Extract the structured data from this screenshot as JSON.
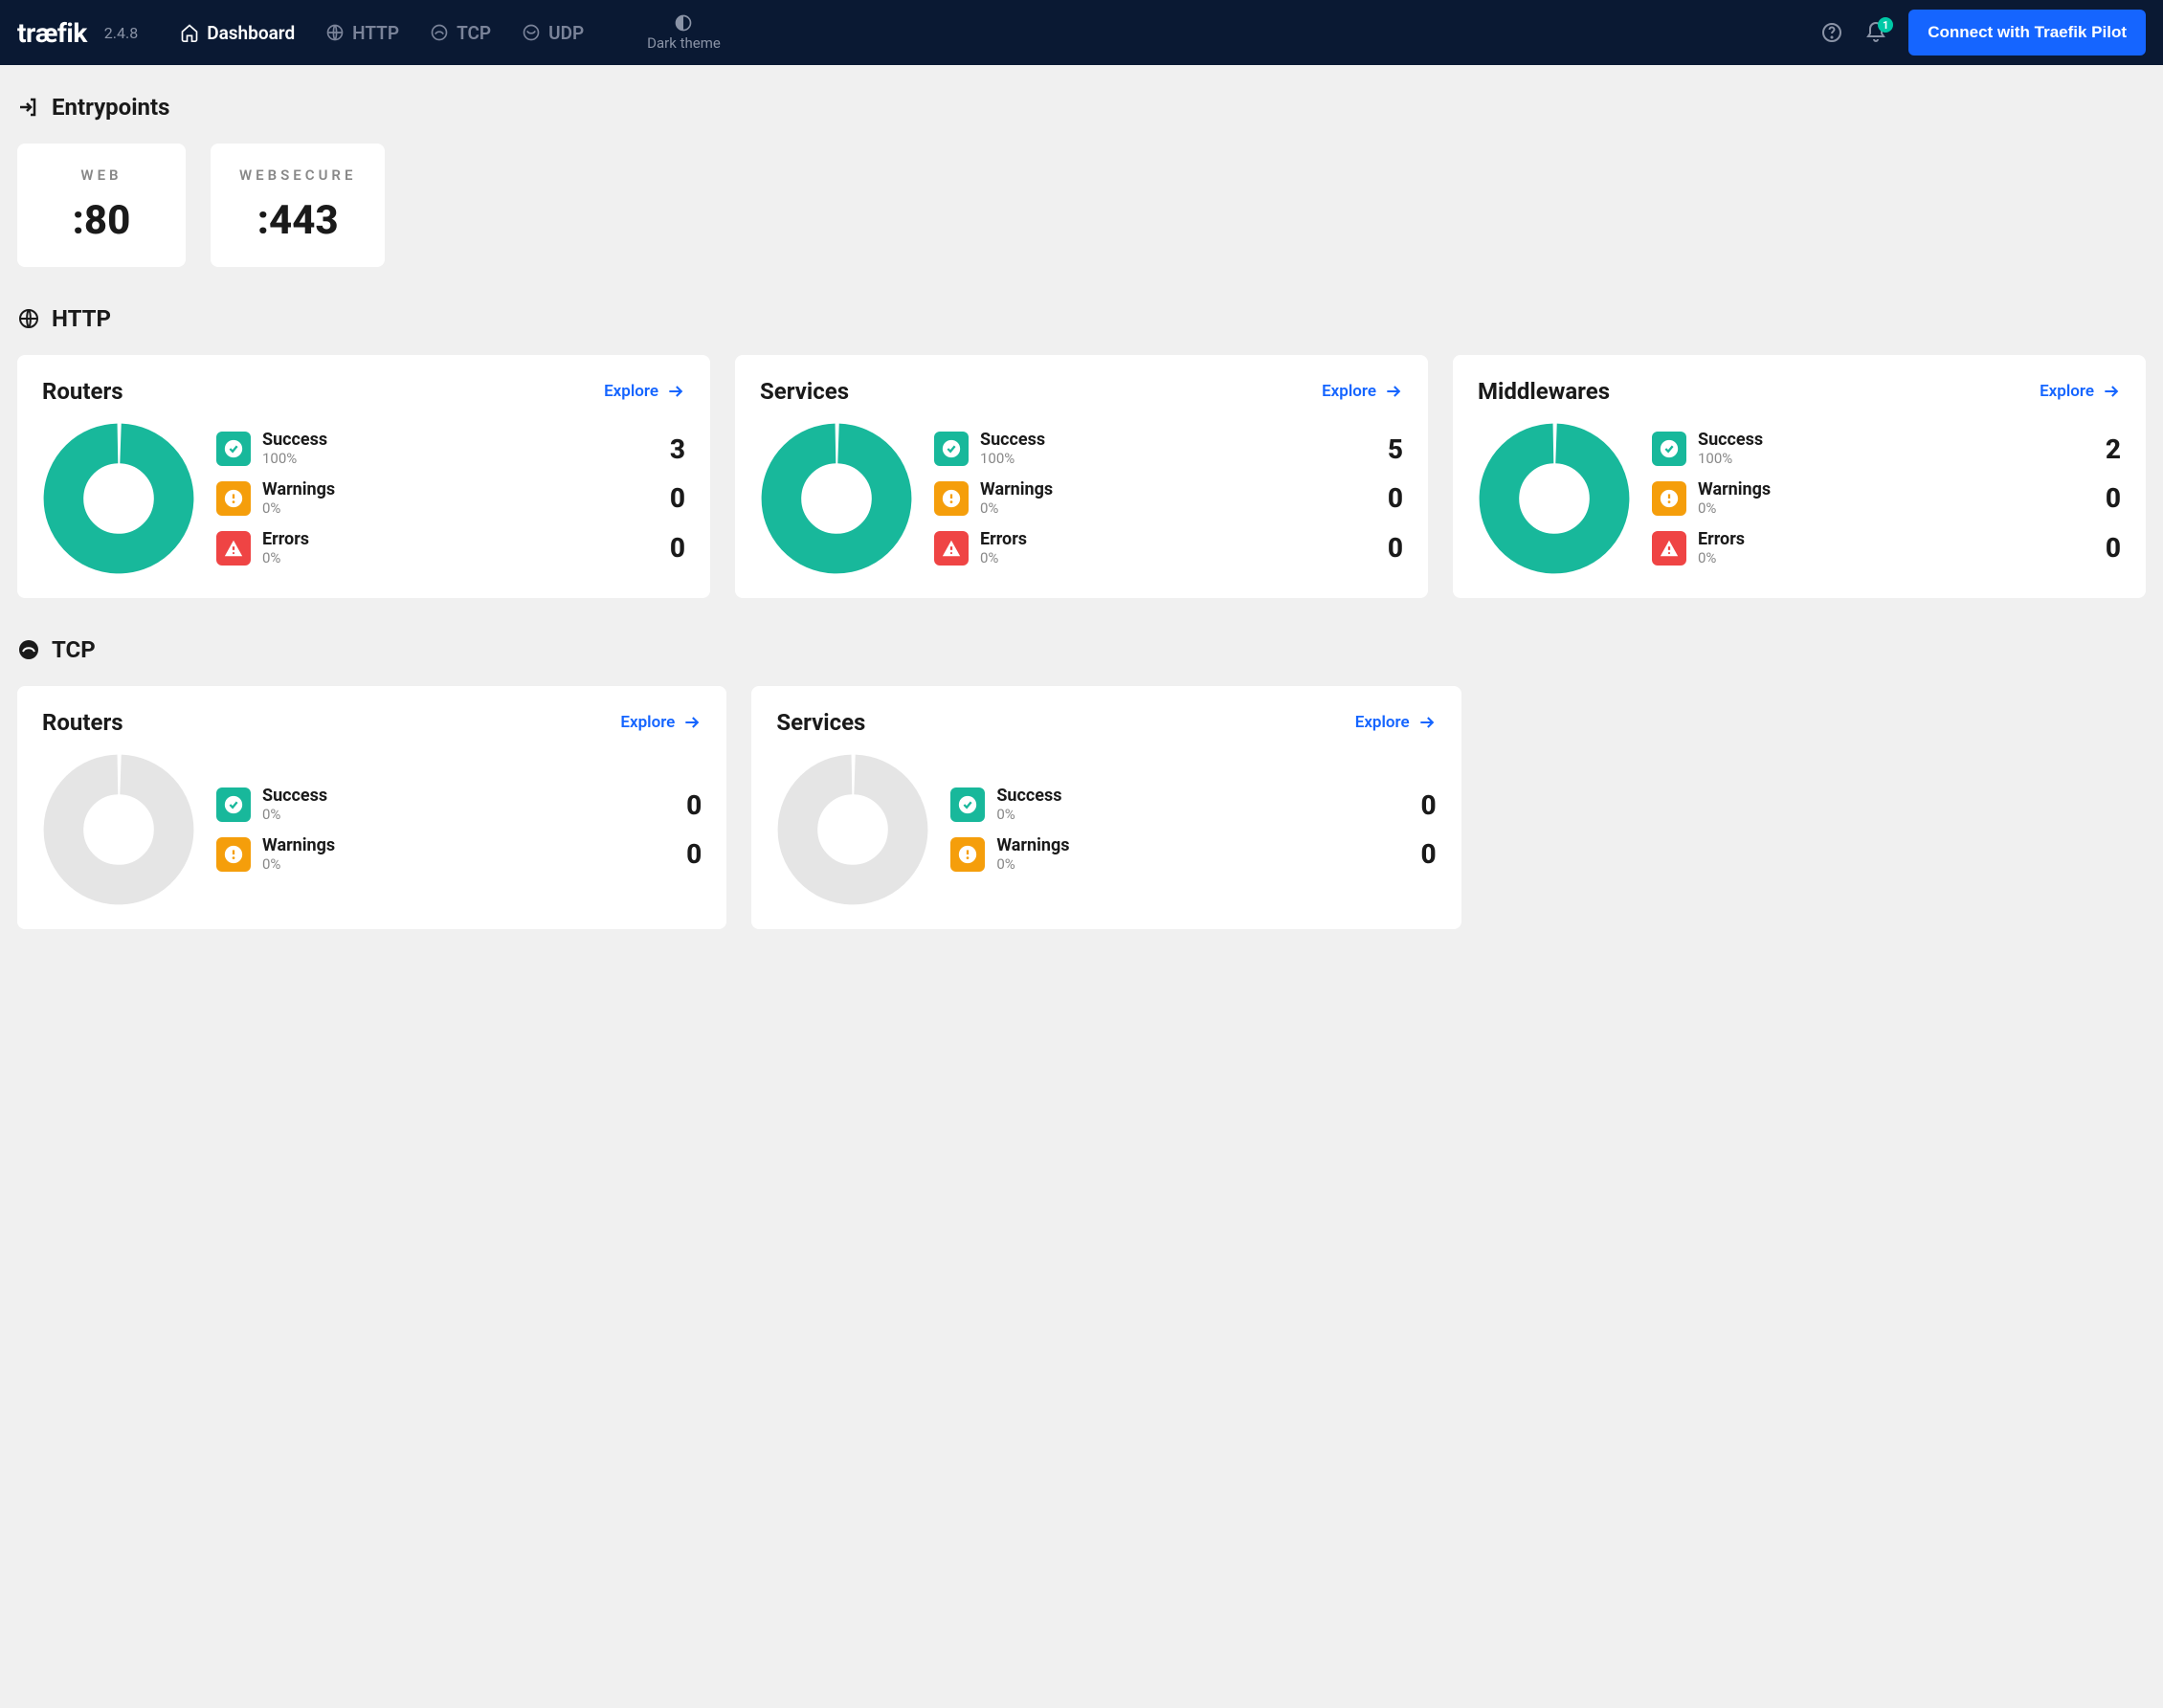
{
  "header": {
    "logo": "træfik",
    "version": "2.4.8",
    "nav": {
      "dashboard": "Dashboard",
      "http": "HTTP",
      "tcp": "TCP",
      "udp": "UDP"
    },
    "theme_toggle": "Dark theme",
    "notif_count": "1",
    "pilot_button": "Connect with Traefik Pilot"
  },
  "sections": {
    "entrypoints": {
      "title": "Entrypoints"
    },
    "http": {
      "title": "HTTP"
    },
    "tcp": {
      "title": "TCP"
    }
  },
  "entrypoints": [
    {
      "name": "WEB",
      "port": ":80"
    },
    {
      "name": "WEBSECURE",
      "port": ":443"
    }
  ],
  "labels": {
    "explore": "Explore",
    "success": "Success",
    "warnings": "Warnings",
    "errors": "Errors"
  },
  "http_panels": {
    "routers": {
      "title": "Routers",
      "success_pct": "100%",
      "success_n": "3",
      "warn_pct": "0%",
      "warn_n": "0",
      "err_pct": "0%",
      "err_n": "0",
      "donut_color": "#18b89b"
    },
    "services": {
      "title": "Services",
      "success_pct": "100%",
      "success_n": "5",
      "warn_pct": "0%",
      "warn_n": "0",
      "err_pct": "0%",
      "err_n": "0",
      "donut_color": "#18b89b"
    },
    "middlewares": {
      "title": "Middlewares",
      "success_pct": "100%",
      "success_n": "2",
      "warn_pct": "0%",
      "warn_n": "0",
      "err_pct": "0%",
      "err_n": "0",
      "donut_color": "#18b89b"
    }
  },
  "tcp_panels": {
    "routers": {
      "title": "Routers",
      "success_pct": "0%",
      "success_n": "0",
      "warn_pct": "0%",
      "warn_n": "0",
      "donut_color": "#e5e5e5"
    },
    "services": {
      "title": "Services",
      "success_pct": "0%",
      "success_n": "0",
      "warn_pct": "0%",
      "warn_n": "0",
      "donut_color": "#e5e5e5"
    }
  },
  "chart_data": [
    {
      "type": "pie",
      "title": "HTTP Routers",
      "categories": [
        "Success",
        "Warnings",
        "Errors"
      ],
      "values": [
        3,
        0,
        0
      ]
    },
    {
      "type": "pie",
      "title": "HTTP Services",
      "categories": [
        "Success",
        "Warnings",
        "Errors"
      ],
      "values": [
        5,
        0,
        0
      ]
    },
    {
      "type": "pie",
      "title": "HTTP Middlewares",
      "categories": [
        "Success",
        "Warnings",
        "Errors"
      ],
      "values": [
        2,
        0,
        0
      ]
    },
    {
      "type": "pie",
      "title": "TCP Routers",
      "categories": [
        "Success",
        "Warnings",
        "Errors"
      ],
      "values": [
        0,
        0,
        0
      ]
    },
    {
      "type": "pie",
      "title": "TCP Services",
      "categories": [
        "Success",
        "Warnings",
        "Errors"
      ],
      "values": [
        0,
        0,
        0
      ]
    }
  ]
}
